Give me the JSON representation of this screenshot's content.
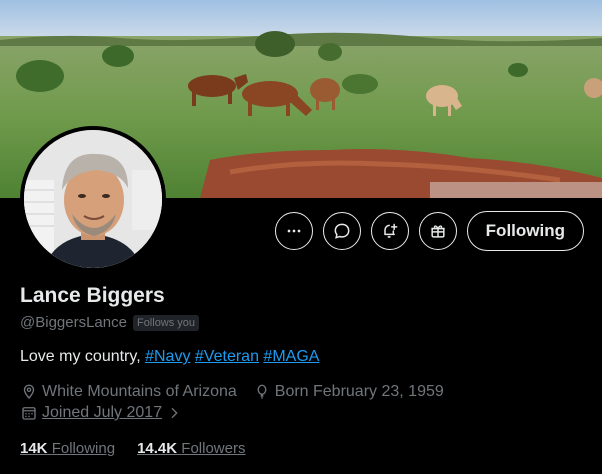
{
  "profile": {
    "name": "Lance Biggers",
    "handle": "@BiggersLance",
    "follows_you": "Follows you",
    "bio_text": "Love my country, ",
    "hashtags": [
      "#Navy",
      "#Veteran",
      "#MAGA"
    ],
    "location": "White Mountains of Arizona",
    "born": "Born February 23, 1959",
    "joined": "Joined July 2017",
    "following_count": "14K",
    "following_label": "Following",
    "followers_count": "14.4K",
    "followers_label": "Followers"
  },
  "actions": {
    "more_icon": "more-icon",
    "message_icon": "message-icon",
    "notify_icon": "notification-add-icon",
    "gift_icon": "gift-icon",
    "follow_label": "Following"
  },
  "colors": {
    "background": "#000000",
    "text": "#e7e9ea",
    "secondary": "#71767b",
    "accent": "#1d9bf0"
  }
}
